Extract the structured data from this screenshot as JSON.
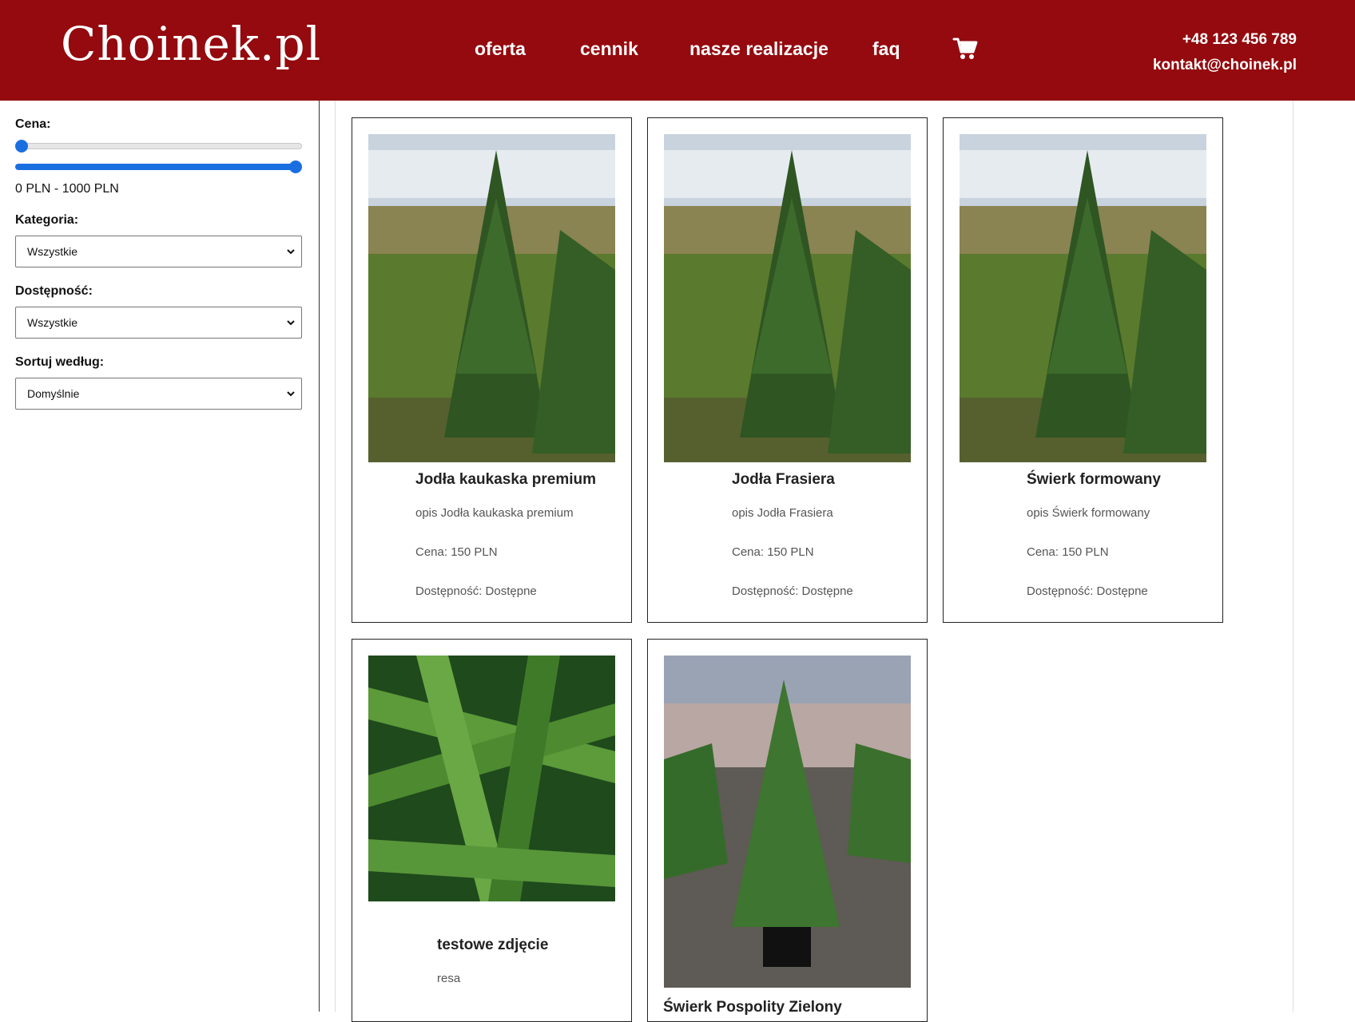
{
  "header": {
    "logo": "Choinek.pl",
    "nav": [
      "oferta",
      "cennik",
      "nasze realizacje",
      "faq"
    ],
    "phone": "+48 123 456 789",
    "email": "kontakt@choinek.pl",
    "bg_color": "#940a0e"
  },
  "sidebar": {
    "price_label": "Cena:",
    "price_min_value": 0,
    "price_max_value": 1000,
    "price_range_text": "0 PLN - 1000 PLN",
    "category_label": "Kategoria:",
    "category_value": "Wszystkie",
    "availability_label": "Dostępność:",
    "availability_value": "Wszystkie",
    "sort_label": "Sortuj według:",
    "sort_value": "Domyślnie",
    "slider_color": "#1a6fe0"
  },
  "products": [
    {
      "title": "Jodła kaukaska premium",
      "desc": "opis Jodła kaukaska premium",
      "price": "Cena: 150 PLN",
      "availability": "Dostępność: Dostępne"
    },
    {
      "title": "Jodła Frasiera",
      "desc": "opis Jodła Frasiera",
      "price": "Cena: 150 PLN",
      "availability": "Dostępność: Dostępne"
    },
    {
      "title": "Świerk formowany",
      "desc": "opis Świerk formowany",
      "price": "Cena: 150 PLN",
      "availability": "Dostępność: Dostępne"
    },
    {
      "title": "testowe zdjęcie",
      "desc": "resa"
    },
    {
      "title": "Świerk Pospolity Zielony"
    }
  ]
}
